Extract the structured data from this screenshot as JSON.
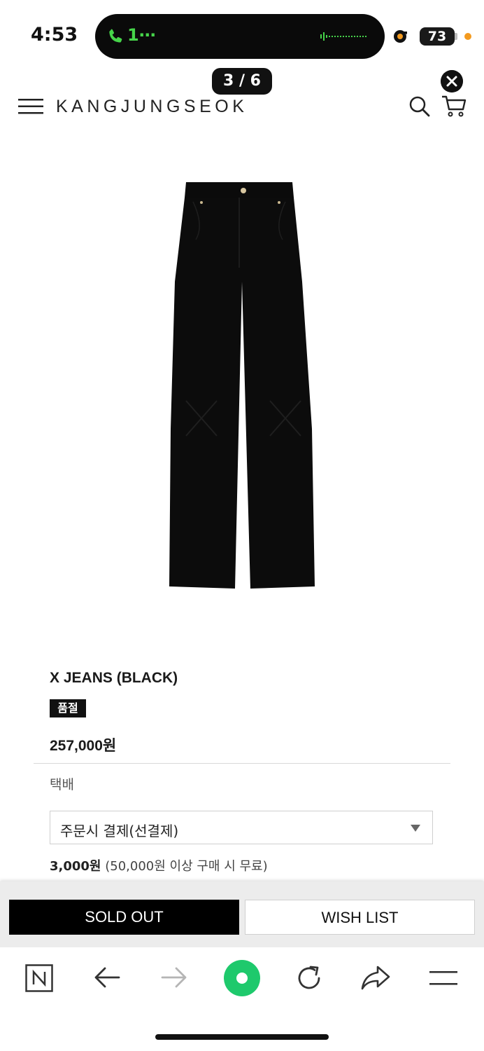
{
  "status_bar": {
    "time": "4:53",
    "call_indicator": "1⋯",
    "battery": "73",
    "colors": {
      "call_green": "#46d44a",
      "recording_dot": "#f39a1f"
    }
  },
  "viewer": {
    "counter": "3 / 6",
    "close_icon": "close-icon"
  },
  "header": {
    "menu_icon": "hamburger-menu-icon",
    "brand": "KANGJUNGSEOK",
    "search_icon": "search-icon",
    "cart_icon": "cart-icon"
  },
  "product": {
    "image_icon": "black-jeans-image",
    "title": "X JEANS (BLACK)",
    "badge": "품절",
    "price": "257,000원"
  },
  "delivery": {
    "label": "택배",
    "select_value": "주문시 결제(선결제)",
    "fee_amount": "3,000원",
    "fee_note": "(50,000원 이상 구매 시 무료)"
  },
  "actions": {
    "sold_out": "SOLD OUT",
    "wish_list": "WISH LIST"
  },
  "browser_toolbar": {
    "items": [
      "naver-n-icon",
      "back-arrow-icon",
      "forward-arrow-icon",
      "green-circle-icon",
      "reload-icon",
      "share-icon",
      "menu-icon"
    ],
    "accent": "#1ec96c"
  }
}
